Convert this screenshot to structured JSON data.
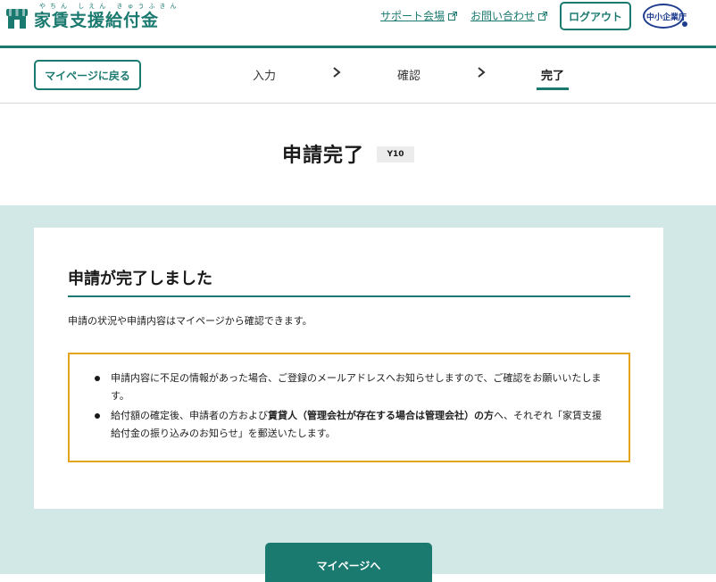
{
  "header": {
    "logo_ruby": "やちん しえん きゅうふきん",
    "logo_text": "家賃支援給付金",
    "support_link": "サポート会場",
    "contact_link": "お問い合わせ",
    "logout_label": "ログアウト",
    "agency_label": "中小企業庁",
    "accent_color": "#1b7a70"
  },
  "stepbar": {
    "back_label": "マイページに戻る",
    "steps": [
      "入力",
      "確認",
      "完了"
    ],
    "active_step": "完了"
  },
  "title": {
    "text": "申請完了",
    "badge": "Y10"
  },
  "card": {
    "heading": "申請が完了しました",
    "description": "申請の状況や申請内容はマイページから確認できます。",
    "notices": [
      {
        "text": "申請内容に不足の情報があった場合、ご登録のメールアドレスへお知らせしますので、ご確認をお願いいたします。"
      },
      {
        "pre": "給付額の確定後、申請者の方および",
        "bold": "賃貸人（管理会社が存在する場合は管理会社）の方",
        "post": "へ、それぞれ「家賃支援給付金の振り込みのお知らせ」を郵送いたします。"
      }
    ]
  },
  "mypage_button_label": "マイページへ"
}
